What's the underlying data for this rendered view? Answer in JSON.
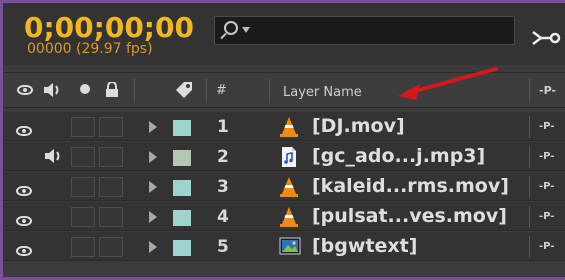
{
  "timecode": "0;00;00;00",
  "frame_rate": "00000 (29.97 fps)",
  "search": {
    "placeholder": ""
  },
  "header": {
    "hash": "#",
    "layer_name": "Layer Name",
    "parent_glyph": "-P-"
  },
  "colors": {
    "timecode": "#f2b71d",
    "frame": "#7a4f9a",
    "arrow": "#d6171b",
    "search_bg": "#1b1b1b"
  },
  "layers": [
    {
      "num": "1",
      "name": "[DJ.mov]",
      "type": "vlc-cone-icon",
      "label_color": "#9fd3ce",
      "eye": true,
      "audio": false,
      "parent_glyph": "-P-"
    },
    {
      "num": "2",
      "name": "[gc_ado...j.mp3]",
      "type": "audio-file-icon",
      "label_color": "#b3c7b1",
      "eye": false,
      "audio": true,
      "parent_glyph": "-P-"
    },
    {
      "num": "3",
      "name": "[kaleid...rms.mov]",
      "type": "vlc-cone-icon",
      "label_color": "#9fd3ce",
      "eye": true,
      "audio": false,
      "parent_glyph": "-P-"
    },
    {
      "num": "4",
      "name": "[pulsat...ves.mov]",
      "type": "vlc-cone-icon",
      "label_color": "#9fd3ce",
      "eye": true,
      "audio": false,
      "parent_glyph": "-P-"
    },
    {
      "num": "5",
      "name": "[bgwtext]",
      "type": "image-file-icon",
      "label_color": "#9fd3ce",
      "eye": true,
      "audio": false,
      "parent_glyph": "-P-"
    }
  ]
}
